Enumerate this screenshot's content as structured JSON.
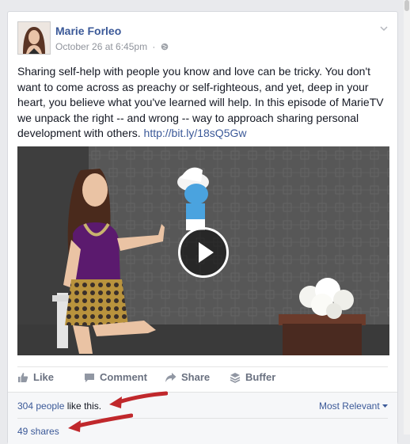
{
  "post": {
    "author": "Marie Forleo",
    "timestamp": "October 26 at 6:45pm",
    "separator": "·",
    "text": "Sharing self-help with people you know and love can be tricky. You don't want to come across as preachy or self-righteous, and yet, deep in your heart, you believe what you've learned will help. In this episode of MarieTV we unpack the right -- and wrong -- way to approach sharing personal development with others. ",
    "link": "http://bit.ly/18sQ5Gw"
  },
  "actions": {
    "like": "Like",
    "comment": "Comment",
    "share": "Share",
    "buffer": "Buffer"
  },
  "footer": {
    "likes_link": "304 people",
    "likes_rest": " like this.",
    "sort": "Most Relevant",
    "shares": "49 shares"
  },
  "colors": {
    "link": "#3b5998",
    "arrow": "#c0282c",
    "background": "#e9eaed"
  },
  "icons": [
    "globe-icon",
    "chevron-down-icon",
    "like-icon",
    "comment-icon",
    "share-icon",
    "buffer-icon",
    "play-icon",
    "arrow-annotation"
  ]
}
